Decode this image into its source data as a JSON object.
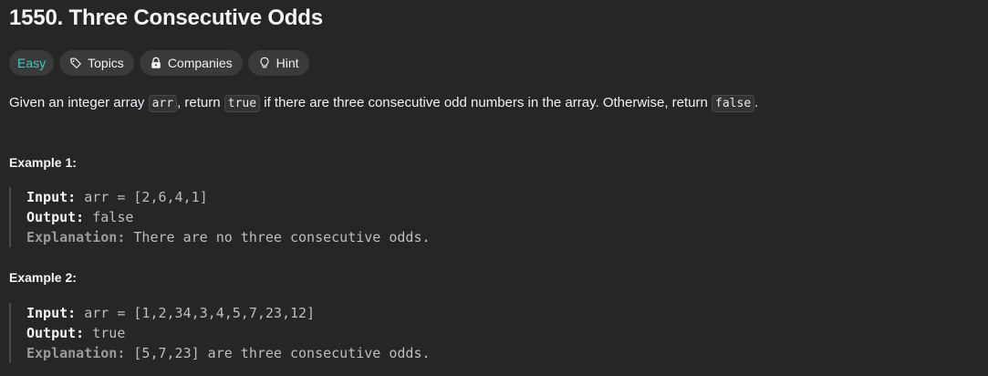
{
  "problem": {
    "title": "1550. Three Consecutive Odds"
  },
  "tags": {
    "difficulty": "Easy",
    "topics": "Topics",
    "companies": "Companies",
    "hint": "Hint"
  },
  "description": {
    "part1": "Given an integer array ",
    "code1": "arr",
    "part2": ", return ",
    "code2": "true",
    "part3": " if there are three consecutive odd numbers in the array. Otherwise, return ",
    "code3": "false",
    "part4": "."
  },
  "examples": [
    {
      "title": "Example 1:",
      "input_label": "Input:",
      "input_value": "arr = [2,6,4,1]",
      "output_label": "Output:",
      "output_value": "false",
      "explanation_label": "Explanation:",
      "explanation_value": "There are no three consecutive odds."
    },
    {
      "title": "Example 2:",
      "input_label": "Input:",
      "input_value": "arr = [1,2,34,3,4,5,7,23,12]",
      "output_label": "Output:",
      "output_value": "true",
      "explanation_label": "Explanation:",
      "explanation_value": "[5,7,23] are three consecutive odds."
    }
  ],
  "colors": {
    "background": "#262626",
    "easy": "#46c6c2",
    "tag_bg": "#3a3a3a"
  },
  "icons": {
    "topics": "tag-icon",
    "companies": "lock-icon",
    "hint": "lightbulb-icon"
  }
}
